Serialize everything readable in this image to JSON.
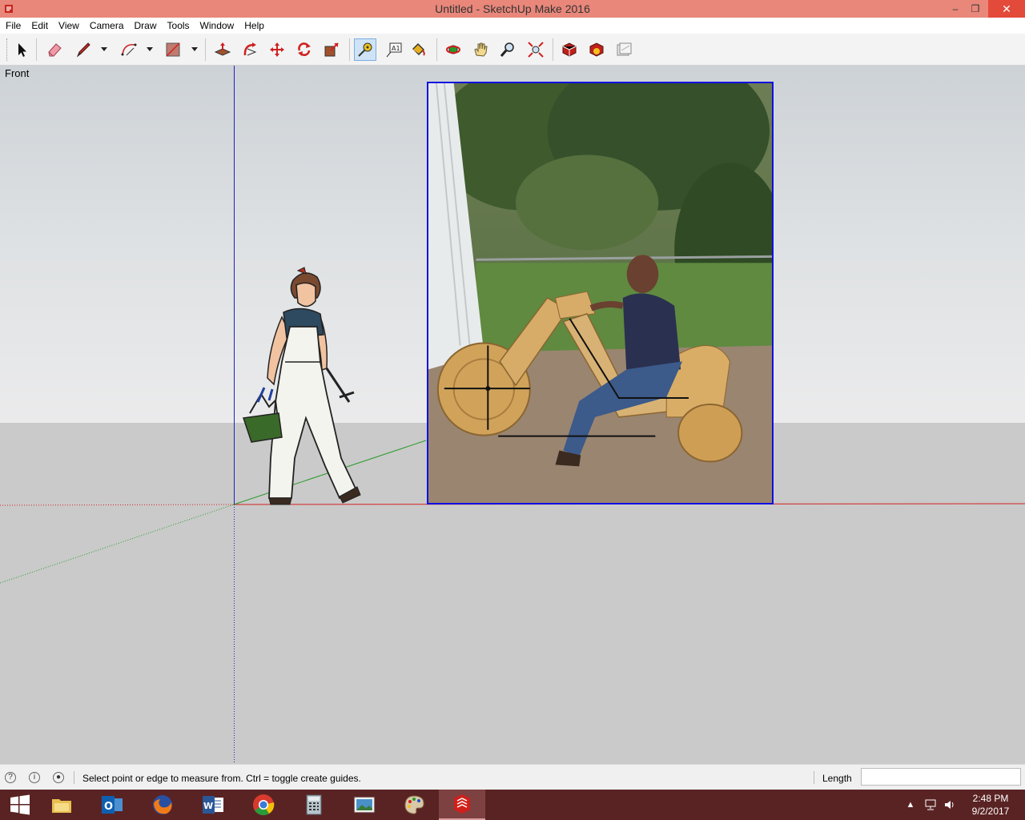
{
  "window": {
    "title": "Untitled - SketchUp Make 2016",
    "minimize": "‒",
    "restore": "❐",
    "close": "✕"
  },
  "menu": [
    "File",
    "Edit",
    "View",
    "Camera",
    "Draw",
    "Tools",
    "Window",
    "Help"
  ],
  "toolbar": {
    "tools": [
      "select",
      "eraser",
      "pencil-line",
      "arc",
      "rectangle",
      "push-pull",
      "follow-me",
      "move",
      "rotate",
      "scale",
      "tape-measure",
      "text",
      "paint-bucket",
      "orbit",
      "pan",
      "zoom",
      "zoom-extents",
      "3d-warehouse",
      "extension-warehouse",
      "layout"
    ],
    "active_tool": "tape-measure"
  },
  "viewport": {
    "view_name": "Front"
  },
  "status": {
    "message": "Select point or edge to measure from.  Ctrl = toggle create guides.",
    "measurement_label": "Length",
    "measurement_value": ""
  },
  "taskbar": {
    "apps": [
      "file-explorer",
      "outlook",
      "firefox",
      "word",
      "chrome",
      "calculator",
      "photos",
      "paint",
      "sketchup"
    ],
    "active_app": "sketchup",
    "time": "2:48 PM",
    "date": "9/2/2017",
    "tray_arrow": "▲"
  },
  "colors": {
    "titlebar": "#e8877a",
    "close_button": "#e44a3a",
    "taskbar": "#5a2323",
    "axis_red": "#d42020",
    "axis_green": "#2a9a2a",
    "axis_blue": "#2020c0",
    "image_border": "#1010e0"
  }
}
